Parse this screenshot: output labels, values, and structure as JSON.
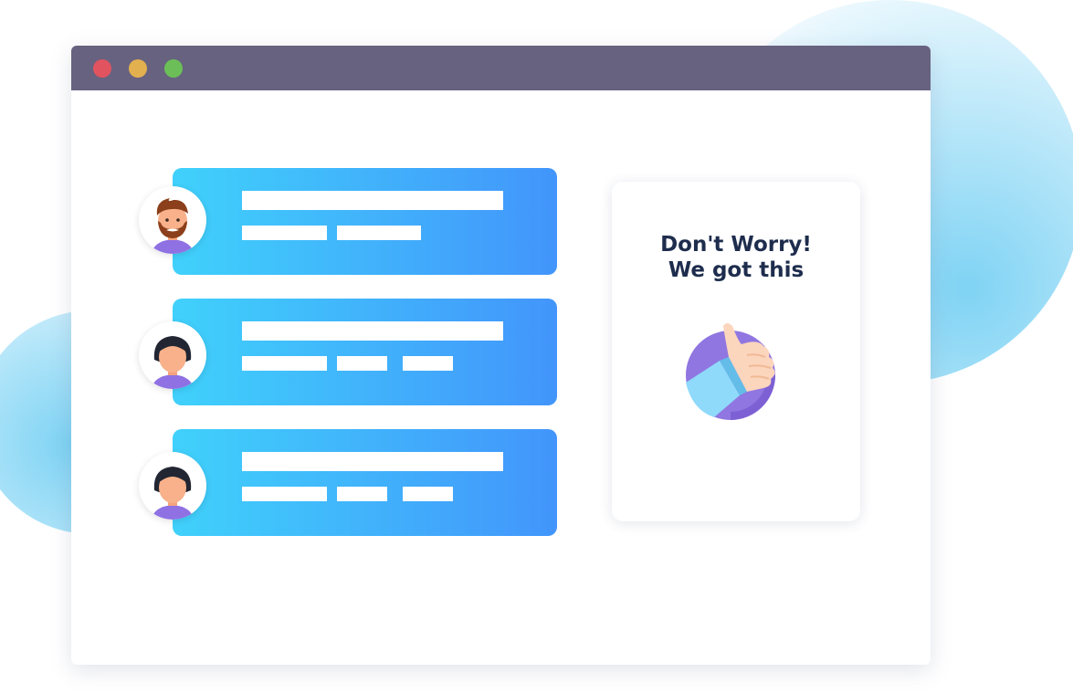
{
  "colors": {
    "titlebar": "#67627f",
    "dot_red": "#e0535f",
    "dot_yellow": "#e3b04f",
    "dot_green": "#6cbf58",
    "card_gradient_start": "#40d1fb",
    "card_gradient_end": "#4295fb",
    "heading_text": "#1e2d4d"
  },
  "window": {
    "controls": [
      "close-dot",
      "minimize-dot",
      "maximize-dot"
    ]
  },
  "messages": [
    {
      "avatar": "man-with-beard-avatar"
    },
    {
      "avatar": "woman-avatar"
    },
    {
      "avatar": "woman-avatar"
    }
  ],
  "side_card": {
    "line1": "Don't Worry!",
    "line2": "We got this",
    "icon": "thumbs-up-icon"
  }
}
